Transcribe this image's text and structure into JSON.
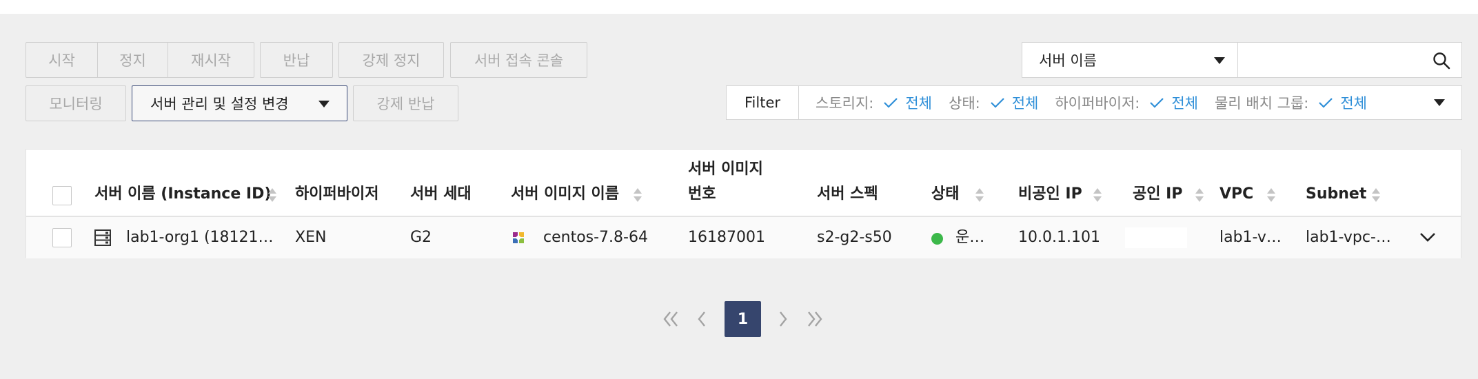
{
  "actions": {
    "start": "시작",
    "stop": "정지",
    "restart": "재시작",
    "return": "반납",
    "force_stop": "강제 정지",
    "console": "서버 접속 콘솔",
    "monitoring": "모니터링",
    "manage": "서버 관리 및 설정 변경",
    "force_return": "강제 반납"
  },
  "search": {
    "field": "서버 이름",
    "value": ""
  },
  "filter": {
    "label": "Filter",
    "items": [
      {
        "name": "스토리지:",
        "value": "전체"
      },
      {
        "name": "상태:",
        "value": "전체"
      },
      {
        "name": "하이퍼바이저:",
        "value": "전체"
      },
      {
        "name": "물리 배치 그룹:",
        "value": "전체"
      }
    ]
  },
  "table": {
    "headers": {
      "name": "서버 이름 (Instance ID)",
      "hypervisor": "하이퍼바이저",
      "generation": "서버 세대",
      "image_name": "서버 이미지 이름",
      "image_no_line1": "서버 이미지",
      "image_no_line2": "번호",
      "spec": "서버 스펙",
      "status": "상태",
      "private_ip": "비공인 IP",
      "public_ip": "공인 IP",
      "vpc": "VPC",
      "subnet": "Subnet"
    },
    "rows": [
      {
        "name": "lab1-org1 (18121…",
        "hypervisor": "XEN",
        "generation": "G2",
        "image_name": "centos-7.8-64",
        "image_no": "16187001",
        "spec": "s2-g2-s50",
        "status": "운…",
        "status_color": "#3cb84a",
        "private_ip": "10.0.1.101",
        "public_ip": "",
        "vpc": "lab1-v…",
        "subnet": "lab1-vpc-…"
      }
    ]
  },
  "pagination": {
    "current": "1"
  },
  "colors": {
    "accent": "#36456d",
    "link": "#2f8fd8"
  }
}
